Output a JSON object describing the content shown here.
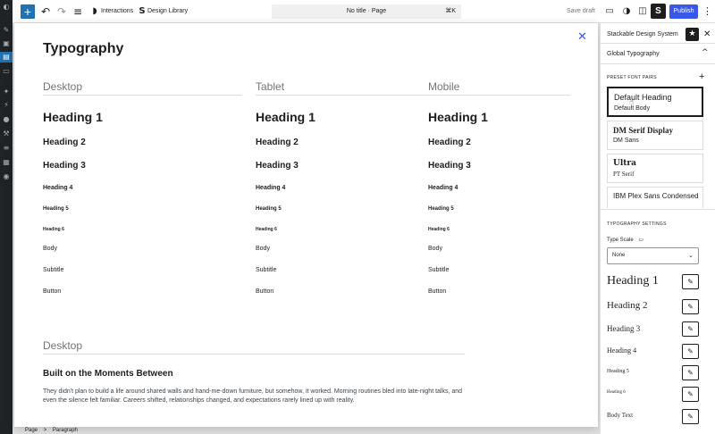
{
  "admin_sidebar": {
    "icons": [
      "dashboard-icon",
      "posts-icon",
      "media-icon",
      "pages-icon",
      "comments-icon",
      "appearance-icon",
      "plugins-icon",
      "users-icon",
      "tools-icon",
      "settings-icon",
      "stackable-icon",
      "collapse-icon"
    ]
  },
  "toolbar": {
    "add_symbol": "+",
    "undo_symbol": "↶",
    "redo_symbol": "↷",
    "list_view_symbol": "≡",
    "interactions_label": "Interactions",
    "design_library_label": "Design Library",
    "document_title": "No title · Page",
    "document_shortcut": "⌘K",
    "save_draft_label": "Save draft",
    "stackable_symbol": "S",
    "publish_label": "Publish",
    "more_symbol": "⋮",
    "accent_color": "#3858e9",
    "add_color": "#2271b1"
  },
  "modal": {
    "title": "Typography",
    "close_symbol": "✕",
    "columns": [
      {
        "label": "Desktop"
      },
      {
        "label": "Tablet"
      },
      {
        "label": "Mobile"
      }
    ],
    "rows": [
      "Heading 1",
      "Heading 2",
      "Heading 3",
      "Heading 4",
      "Heading 5",
      "Heading 6",
      "Body",
      "Subtitle",
      "Button"
    ],
    "preview": {
      "label": "Desktop",
      "heading": "Built on the Moments Between",
      "paragraph": "They didn't plan to build a life around shared walls and hand-me-down furniture, but somehow, it worked. Morning routines bled into late-night talks, and even the silence felt familiar. Careers shifted, relationships changed, and expectations rarely lined up with reality."
    }
  },
  "breadcrumb": {
    "items": [
      "Page",
      "Paragraph"
    ],
    "separator": ">"
  },
  "panel": {
    "title": "Stackable Design System",
    "star_symbol": "★",
    "close_symbol": "✕",
    "section_title": "Global Typography",
    "collapse_symbol": "^",
    "preset_label": "PRESET FONT PAIRS",
    "add_symbol": "+",
    "font_pairs": [
      {
        "heading": "Default Heading",
        "body": "Default Body",
        "selected": true
      },
      {
        "heading": "DM Serif Display",
        "body": "DM Sans",
        "selected": false
      },
      {
        "heading": "Ultra",
        "body": "PT Serif",
        "selected": false
      },
      {
        "heading": "IBM Plex Sans Condensed",
        "body": "",
        "selected": false
      }
    ],
    "settings_label": "TYPOGRAPHY SETTINGS",
    "type_scale_label": "Type Scale",
    "type_scale_value": "None",
    "select_chevron": "⌄",
    "edit_symbol": "✎",
    "typography_rows": [
      "Heading 1",
      "Heading 2",
      "Heading 3",
      "Heading 4",
      "Heading 5",
      "Heading 6",
      "Body Text"
    ]
  }
}
